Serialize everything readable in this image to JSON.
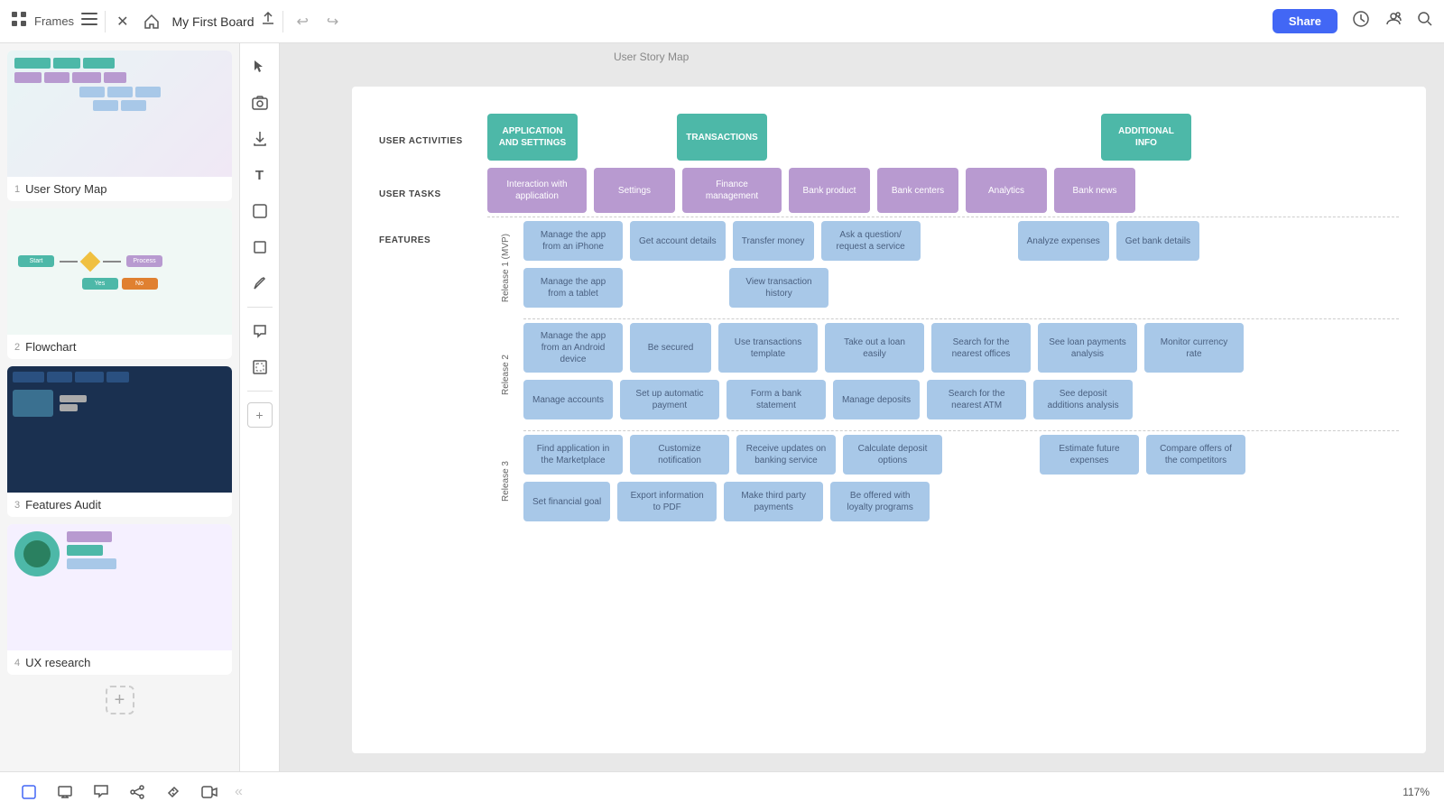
{
  "app": {
    "title": "Frames",
    "board_name": "My First Board"
  },
  "topbar": {
    "undo_label": "↩",
    "redo_label": "↪",
    "share_label": "Share"
  },
  "frames": [
    {
      "num": "1",
      "name": "User Story Map"
    },
    {
      "num": "2",
      "name": "Flowchart"
    },
    {
      "num": "3",
      "name": "Features Audit"
    },
    {
      "num": "4",
      "name": "UX research"
    }
  ],
  "frame_label": "User Story Map",
  "story_map": {
    "user_activities_label": "USER ACTIVITIES",
    "user_tasks_label": "USER TASKS",
    "features_label": "FEATURES",
    "activities": [
      {
        "label": "APPLICATION AND SETTINGS",
        "type": "teal"
      },
      {
        "label": "TRANSACTIONS",
        "type": "teal"
      },
      {
        "label": "ADDITIONAL INFO",
        "type": "teal"
      }
    ],
    "tasks": [
      {
        "label": "Interaction with application",
        "type": "purple"
      },
      {
        "label": "Settings",
        "type": "purple"
      },
      {
        "label": "Finance management",
        "type": "purple"
      },
      {
        "label": "Bank product",
        "type": "purple"
      },
      {
        "label": "Bank centers",
        "type": "purple"
      },
      {
        "label": "Analytics",
        "type": "purple"
      },
      {
        "label": "Bank news",
        "type": "purple"
      }
    ],
    "releases": [
      {
        "label": "Release 1 (MVP)",
        "rows": [
          [
            {
              "label": "Manage the app from an iPhone",
              "type": "blue"
            },
            {
              "label": "Get account details",
              "type": "blue"
            },
            {
              "label": "Transfer money",
              "type": "blue"
            },
            {
              "label": "Ask a question/ request a service",
              "type": "blue"
            },
            {
              "label": "Analyze expenses",
              "type": "blue"
            },
            {
              "label": "Get bank details",
              "type": "blue"
            }
          ],
          [
            {
              "label": "Manage the app from a tablet",
              "type": "blue"
            },
            {
              "label": "View transaction history",
              "type": "blue"
            }
          ]
        ]
      },
      {
        "label": "Release 2",
        "rows": [
          [
            {
              "label": "Manage the app from an Android device",
              "type": "blue"
            },
            {
              "label": "Be secured",
              "type": "blue"
            },
            {
              "label": "Use transactions template",
              "type": "blue"
            },
            {
              "label": "Take out a loan easily",
              "type": "blue"
            },
            {
              "label": "Search for the nearest offices",
              "type": "blue"
            },
            {
              "label": "See loan payments analysis",
              "type": "blue"
            },
            {
              "label": "Monitor currency rate",
              "type": "blue"
            }
          ],
          [
            {
              "label": "Manage accounts",
              "type": "blue"
            },
            {
              "label": "Set up automatic payment",
              "type": "blue"
            },
            {
              "label": "Form a bank statement",
              "type": "blue"
            },
            {
              "label": "Manage deposits",
              "type": "blue"
            },
            {
              "label": "Search for the nearest ATM",
              "type": "blue"
            },
            {
              "label": "See deposit additions analysis",
              "type": "blue"
            }
          ]
        ]
      },
      {
        "label": "Release 3",
        "rows": [
          [
            {
              "label": "Find application in the Marketplace",
              "type": "blue"
            },
            {
              "label": "Customize notification",
              "type": "blue"
            },
            {
              "label": "Receive updates on banking service",
              "type": "blue"
            },
            {
              "label": "Calculate deposit options",
              "type": "blue"
            },
            {
              "label": "Estimate future expenses",
              "type": "blue"
            },
            {
              "label": "Compare offers of the competitors",
              "type": "blue"
            }
          ],
          [
            {
              "label": "Set financial goal",
              "type": "blue"
            },
            {
              "label": "Export information to PDF",
              "type": "blue"
            },
            {
              "label": "Make third party payments",
              "type": "blue"
            },
            {
              "label": "Be offered with loyalty programs",
              "type": "blue"
            }
          ]
        ]
      }
    ]
  },
  "bottom_toolbar": {
    "zoom_label": "117%"
  },
  "tools": [
    {
      "name": "cursor-tool",
      "icon": "⬆",
      "active": false
    },
    {
      "name": "camera-tool",
      "icon": "⊙",
      "active": false
    },
    {
      "name": "upload-tool",
      "icon": "⬆",
      "active": false
    },
    {
      "name": "text-tool",
      "icon": "T",
      "active": false
    },
    {
      "name": "note-tool",
      "icon": "☐",
      "active": false
    },
    {
      "name": "shape-tool",
      "icon": "◻",
      "active": false
    },
    {
      "name": "pen-tool",
      "icon": "✏",
      "active": false
    },
    {
      "name": "comment-tool",
      "icon": "💬",
      "active": false
    },
    {
      "name": "frame-tool",
      "icon": "⊞",
      "active": false
    }
  ]
}
